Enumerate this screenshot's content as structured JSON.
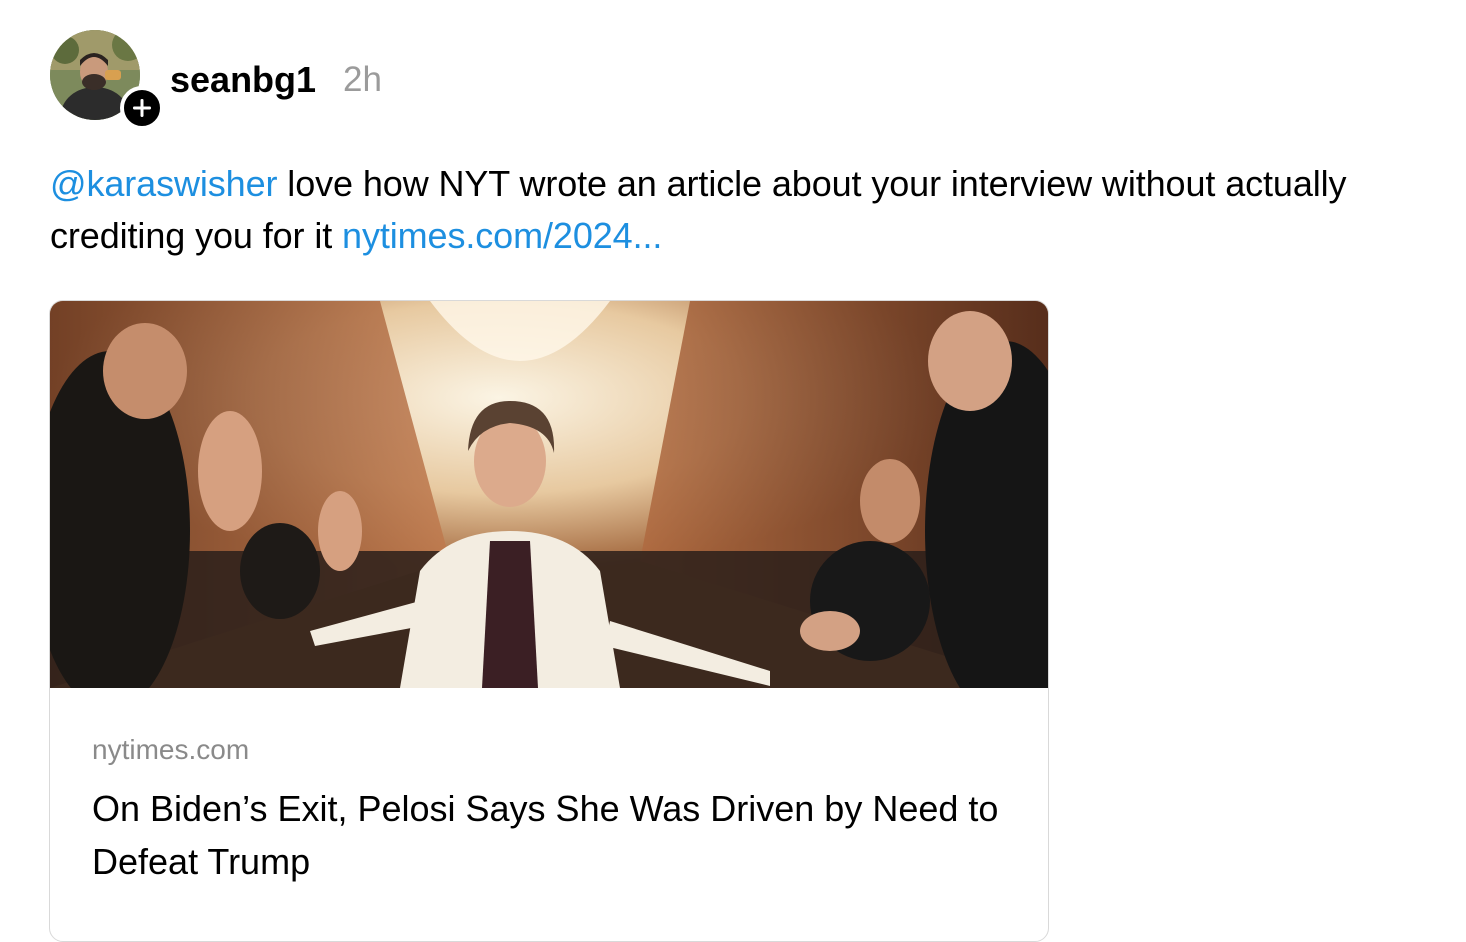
{
  "post": {
    "author": {
      "username": "seanbg1",
      "avatar_icon": "person-photo",
      "follow_icon": "plus-icon"
    },
    "timestamp": "2h",
    "text": {
      "mention": "@karaswisher",
      "body": " love how NYT wrote an article about your interview without actually crediting you for it ",
      "link": "nytimes.com/2024..."
    },
    "link_card": {
      "image_description_icon": "article-photo",
      "domain": "nytimes.com",
      "title": "On Biden’s Exit, Pelosi Says She Was Driven by Need to Defeat Trump"
    }
  },
  "colors": {
    "link": "#1d8fe0",
    "timestamp": "#9b9b9b",
    "card_border": "#d9d9d9",
    "domain": "#8a8a8a"
  }
}
